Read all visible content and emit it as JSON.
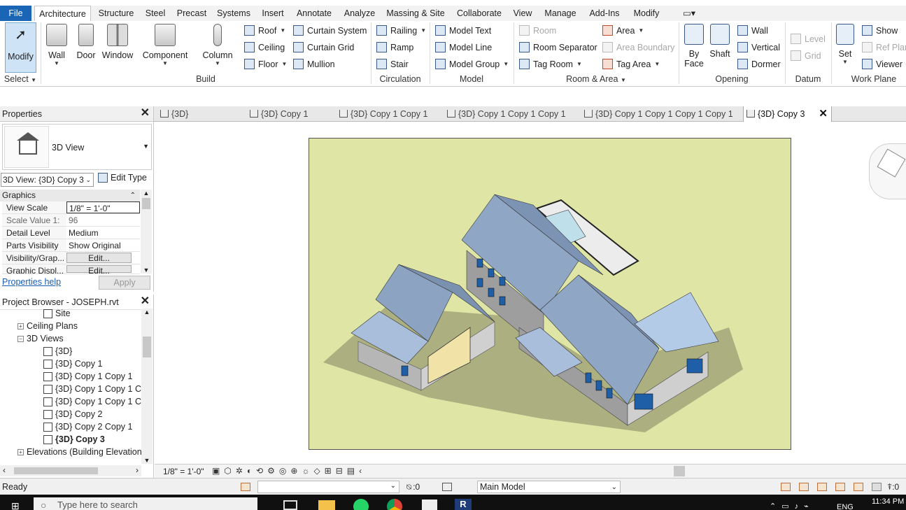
{
  "menu": {
    "tabs": [
      "File",
      "Architecture",
      "Structure",
      "Steel",
      "Precast",
      "Systems",
      "Insert",
      "Annotate",
      "Analyze",
      "Massing & Site",
      "Collaborate",
      "View",
      "Manage",
      "Add-Ins",
      "Modify"
    ],
    "active_tab": "Architecture"
  },
  "ribbon": {
    "modify": "Modify",
    "select": "Select",
    "build": {
      "label": "Build",
      "wall": "Wall",
      "door": "Door",
      "window": "Window",
      "component": "Component",
      "column": "Column",
      "roof": "Roof",
      "ceiling": "Ceiling",
      "floor": "Floor",
      "curtain_system": "Curtain  System",
      "curtain_grid": "Curtain  Grid",
      "mullion": "Mullion"
    },
    "circulation": {
      "label": "Circulation",
      "railing": "Railing",
      "ramp": "Ramp",
      "stair": "Stair"
    },
    "model": {
      "label": "Model",
      "model_text": "Model  Text",
      "model_line": "Model  Line",
      "model_group": "Model  Group"
    },
    "room_area": {
      "label": "Room & Area",
      "room": "Room",
      "room_separator": "Room  Separator",
      "tag_room": "Tag  Room",
      "area": "Area",
      "area_boundary": "Area  Boundary",
      "tag_area": "Tag  Area"
    },
    "opening": {
      "label": "Opening",
      "by_face_1": "By",
      "by_face_2": "Face",
      "shaft": "Shaft",
      "wall": "Wall",
      "vertical": "Vertical",
      "dormer": "Dormer"
    },
    "datum": {
      "label": "Datum",
      "level": "Level",
      "grid": "Grid"
    },
    "work_plane": {
      "label": "Work Plane",
      "set": "Set",
      "show": "Show",
      "ref_plane": "Ref  Plan",
      "viewer": "Viewer"
    }
  },
  "view_tabs": [
    {
      "label": "{3D}"
    },
    {
      "label": "{3D} Copy 1"
    },
    {
      "label": "{3D} Copy 1 Copy 1"
    },
    {
      "label": "{3D} Copy 1 Copy 1 Copy 1"
    },
    {
      "label": "{3D} Copy 1 Copy 1 Copy 1 Copy 1"
    },
    {
      "label": "{3D} Copy 3"
    }
  ],
  "properties": {
    "title": "Properties",
    "type_name": "3D View",
    "instance_selector": "3D View: {3D} Copy 3",
    "edit_type": "Edit Type",
    "section": "Graphics",
    "rows": [
      {
        "key": "View Scale",
        "value": "1/8\" = 1'-0\""
      },
      {
        "key": "Scale Value    1:",
        "value": "96"
      },
      {
        "key": "Detail Level",
        "value": "Medium"
      },
      {
        "key": "Parts Visibility",
        "value": "Show Original"
      },
      {
        "key": "Visibility/Grap...",
        "value": "Edit..."
      },
      {
        "key": "Graphic Displ...",
        "value": "Edit..."
      }
    ],
    "help": "Properties help",
    "apply": "Apply"
  },
  "project_browser": {
    "title": "Project Browser - JOSEPH.rvt",
    "items": [
      "Site",
      "Ceiling Plans",
      "3D Views",
      "{3D}",
      "{3D} Copy 1",
      "{3D} Copy 1 Copy 1",
      "{3D} Copy 1 Copy 1 Co",
      "{3D} Copy 1 Copy 1 Co",
      "{3D} Copy 2",
      "{3D} Copy 2 Copy 1",
      "{3D} Copy 3",
      "Elevations (Building Elevation"
    ]
  },
  "view_control": {
    "scale": "1/8\" = 1'-0\""
  },
  "status": {
    "ready": "Ready",
    "counter": ":0",
    "workset": "Main Model",
    "filter_count": ":0"
  },
  "taskbar": {
    "search": "Type here to search",
    "lang": "ENG",
    "time": "11:34 PM"
  },
  "colors": {
    "file_tab": "#1a65b5",
    "viewport_bg": "#dfe6a5",
    "roof": "#8ca3c2",
    "wall": "#c9c9c9"
  }
}
